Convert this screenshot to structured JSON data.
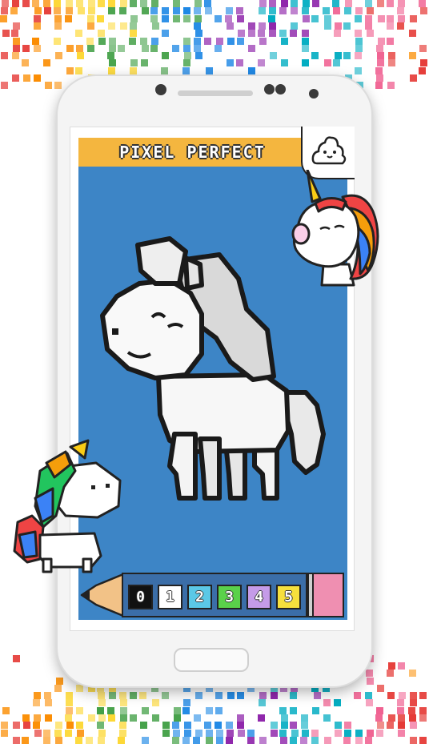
{
  "app": {
    "title": "PIXEL PERFECT"
  },
  "canvas": {
    "background_color": "#3d85c6",
    "subject_icon": "unicorn-pixel-art-icon"
  },
  "palette": {
    "swatches": [
      {
        "number": "0",
        "color": "#111111"
      },
      {
        "number": "1",
        "color": "#ffffff"
      },
      {
        "number": "2",
        "color": "#5bc8e6"
      },
      {
        "number": "3",
        "color": "#5ad14a"
      },
      {
        "number": "4",
        "color": "#c59be8"
      },
      {
        "number": "5",
        "color": "#f6e03d"
      }
    ]
  },
  "colors": {
    "title_bar": "#f4b63f",
    "accent_pink": "#ef8fb1"
  }
}
